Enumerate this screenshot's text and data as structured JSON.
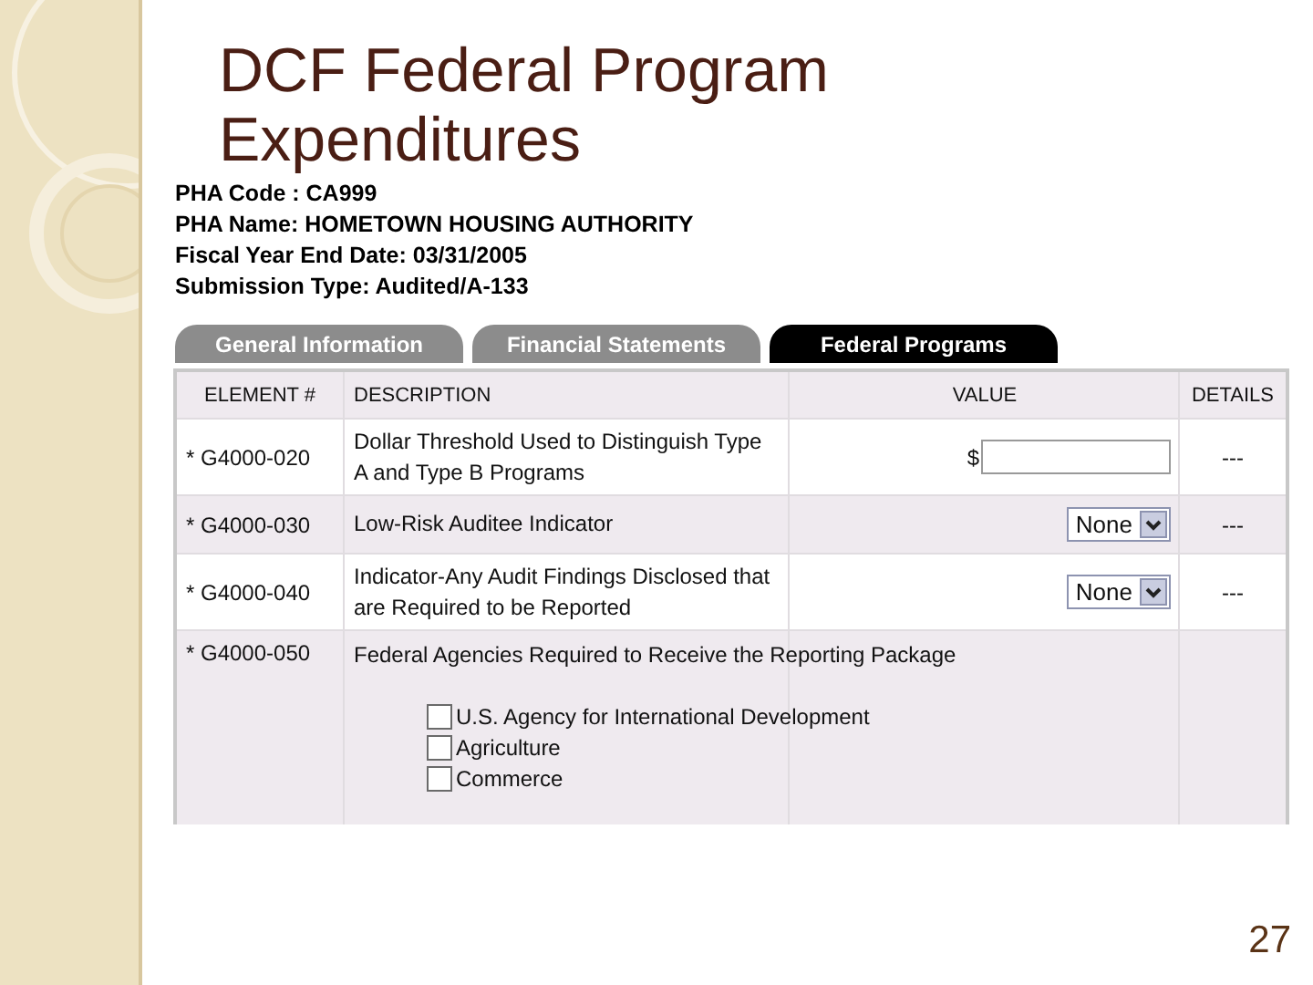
{
  "slide": {
    "title": "DCF Federal Program Expenditures",
    "page_number": "27"
  },
  "info": [
    "PHA Code : CA999",
    "PHA Name: HOMETOWN HOUSING AUTHORITY",
    "Fiscal Year End Date: 03/31/2005",
    "Submission Type: Audited/A-133"
  ],
  "tabs": [
    {
      "label": "General Information",
      "selected": false
    },
    {
      "label": "Financial Statements",
      "selected": false
    },
    {
      "label": "Federal Programs",
      "selected": true
    }
  ],
  "table": {
    "columns": [
      "ELEMENT #",
      "DESCRIPTION",
      "VALUE",
      "DETAILS"
    ],
    "rows": [
      {
        "kind": "amount",
        "element": "* G4000-020",
        "description": "Dollar Threshold Used to Distinguish Type A and Type B Programs",
        "currency": "$",
        "details": "---"
      },
      {
        "kind": "select",
        "element": "* G4000-030",
        "description": "Low-Risk Auditee Indicator",
        "value": "None",
        "details": "---"
      },
      {
        "kind": "select",
        "element": "* G4000-040",
        "description": "Indicator-Any Audit Findings Disclosed that are Required to be Reported",
        "value": "None",
        "details": "---"
      },
      {
        "kind": "checklist",
        "element": "* G4000-050",
        "description": "Federal Agencies Required to Receive the Reporting Package",
        "options": [
          {
            "label": "U.S. Agency for International Development",
            "checked": false
          },
          {
            "label": "Agriculture",
            "checked": false
          },
          {
            "label": "Commerce",
            "checked": false
          }
        ]
      }
    ]
  }
}
